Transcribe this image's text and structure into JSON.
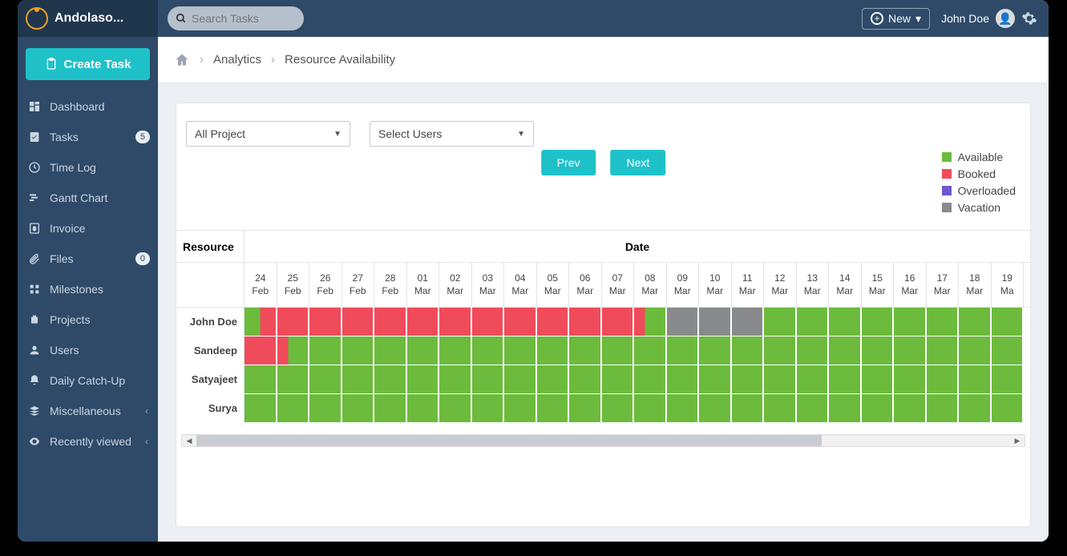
{
  "brand": "Andolaso...",
  "search": {
    "placeholder": "Search Tasks"
  },
  "top": {
    "new_label": "New",
    "user_name": "John Doe"
  },
  "sidebar": {
    "create_task": "Create Task",
    "items": [
      {
        "label": "Dashboard",
        "icon": "dashboard-icon"
      },
      {
        "label": "Tasks",
        "icon": "tasks-icon",
        "badge": "5"
      },
      {
        "label": "Time Log",
        "icon": "clock-icon"
      },
      {
        "label": "Gantt Chart",
        "icon": "gantt-icon"
      },
      {
        "label": "Invoice",
        "icon": "invoice-icon"
      },
      {
        "label": "Files",
        "icon": "files-icon",
        "badge": "0"
      },
      {
        "label": "Milestones",
        "icon": "milestones-icon"
      },
      {
        "label": "Projects",
        "icon": "projects-icon"
      },
      {
        "label": "Users",
        "icon": "users-icon"
      },
      {
        "label": "Daily Catch-Up",
        "icon": "bell-icon"
      },
      {
        "label": "Miscellaneous",
        "icon": "stack-icon",
        "chev": true
      },
      {
        "label": "Recently viewed",
        "icon": "eye-icon",
        "chev": true
      }
    ]
  },
  "breadcrumb": {
    "analytics": "Analytics",
    "page": "Resource Availability"
  },
  "filters": {
    "project": "All Project",
    "users": "Select Users"
  },
  "nav": {
    "prev": "Prev",
    "next": "Next"
  },
  "legend": [
    {
      "label": "Available",
      "color": "#6cbb3c"
    },
    {
      "label": "Booked",
      "color": "#ef4b5b"
    },
    {
      "label": "Overloaded",
      "color": "#6a5acd"
    },
    {
      "label": "Vacation",
      "color": "#888a8c"
    }
  ],
  "table": {
    "resource_header": "Resource",
    "date_header": "Date",
    "dates": [
      {
        "d": "24",
        "m": "Feb"
      },
      {
        "d": "25",
        "m": "Feb"
      },
      {
        "d": "26",
        "m": "Feb"
      },
      {
        "d": "27",
        "m": "Feb"
      },
      {
        "d": "28",
        "m": "Feb"
      },
      {
        "d": "01",
        "m": "Mar"
      },
      {
        "d": "02",
        "m": "Mar"
      },
      {
        "d": "03",
        "m": "Mar"
      },
      {
        "d": "04",
        "m": "Mar"
      },
      {
        "d": "05",
        "m": "Mar"
      },
      {
        "d": "06",
        "m": "Mar"
      },
      {
        "d": "07",
        "m": "Mar"
      },
      {
        "d": "08",
        "m": "Mar"
      },
      {
        "d": "09",
        "m": "Mar"
      },
      {
        "d": "10",
        "m": "Mar"
      },
      {
        "d": "11",
        "m": "Mar"
      },
      {
        "d": "12",
        "m": "Mar"
      },
      {
        "d": "13",
        "m": "Mar"
      },
      {
        "d": "14",
        "m": "Mar"
      },
      {
        "d": "15",
        "m": "Mar"
      },
      {
        "d": "16",
        "m": "Mar"
      },
      {
        "d": "17",
        "m": "Mar"
      },
      {
        "d": "18",
        "m": "Mar"
      },
      {
        "d": "19",
        "m": "Ma"
      }
    ],
    "rows": [
      {
        "name": "John Doe",
        "cells": [
          "split-ab",
          "booked",
          "booked",
          "booked",
          "booked",
          "booked",
          "booked",
          "booked",
          "booked",
          "booked",
          "booked",
          "booked",
          "split-ba",
          "vac",
          "vac",
          "vac",
          "avail",
          "avail",
          "avail",
          "avail",
          "avail",
          "avail",
          "avail",
          "avail"
        ]
      },
      {
        "name": "Sandeep",
        "cells": [
          "booked",
          "split-ba",
          "avail",
          "avail",
          "avail",
          "avail",
          "avail",
          "avail",
          "avail",
          "avail",
          "avail",
          "avail",
          "avail",
          "avail",
          "avail",
          "avail",
          "avail",
          "avail",
          "avail",
          "avail",
          "avail",
          "avail",
          "avail",
          "avail"
        ]
      },
      {
        "name": "Satyajeet",
        "cells": [
          "avail",
          "avail",
          "avail",
          "avail",
          "avail",
          "avail",
          "avail",
          "avail",
          "avail",
          "avail",
          "avail",
          "avail",
          "avail",
          "avail",
          "avail",
          "avail",
          "avail",
          "avail",
          "avail",
          "avail",
          "avail",
          "avail",
          "avail",
          "avail"
        ]
      },
      {
        "name": "Surya",
        "cells": [
          "avail",
          "avail",
          "avail",
          "avail",
          "avail",
          "avail",
          "avail",
          "avail",
          "avail",
          "avail",
          "avail",
          "avail",
          "avail",
          "avail",
          "avail",
          "avail",
          "avail",
          "avail",
          "avail",
          "avail",
          "avail",
          "avail",
          "avail",
          "avail"
        ]
      }
    ]
  },
  "colors": {
    "avail": "#6cbb3c",
    "booked": "#ef4b5b",
    "overloaded": "#6a5acd",
    "vac": "#888a8c"
  }
}
